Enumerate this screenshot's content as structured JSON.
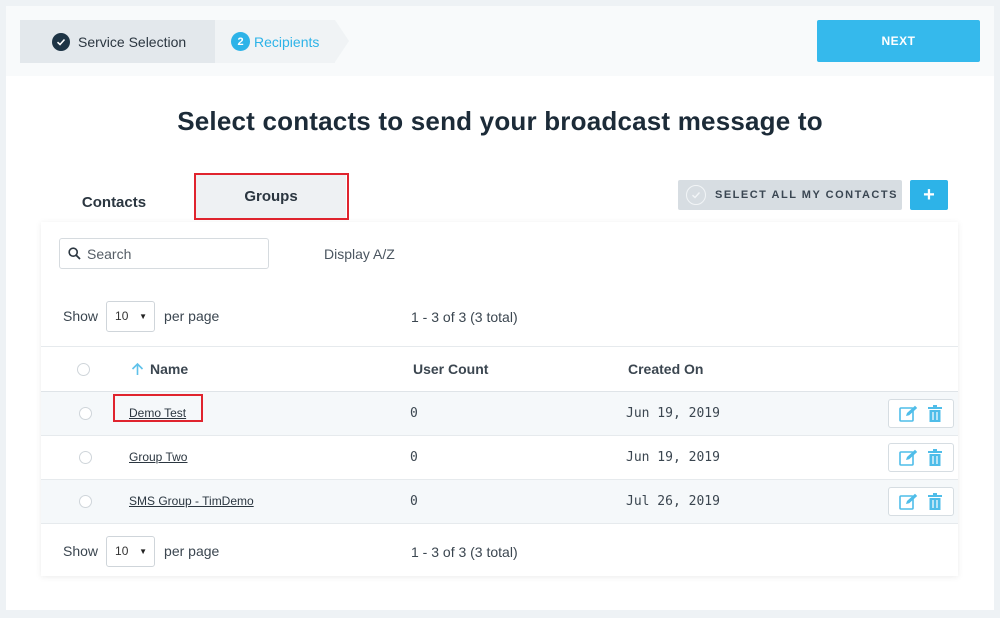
{
  "wizard": {
    "step1_label": "Service Selection",
    "step2_number": "2",
    "step2_label": "Recipients",
    "next_label": "NEXT"
  },
  "page_title": "Select contacts to send your broadcast message to",
  "tabs": [
    {
      "label": "Contacts",
      "active": false
    },
    {
      "label": "Groups",
      "active": true
    }
  ],
  "toolbar": {
    "select_all_label": "SELECT ALL MY CONTACTS",
    "add_label": "+"
  },
  "search": {
    "placeholder": "Search",
    "value": ""
  },
  "display_az_label": "Display A/Z",
  "pagination": {
    "show_label": "Show",
    "per_page_value": "10",
    "per_page_label": "per page",
    "range_text": "1 - 3 of 3 (3 total)"
  },
  "table": {
    "columns": [
      "Name",
      "User Count",
      "Created On"
    ],
    "rows": [
      {
        "name": "Demo Test",
        "user_count": "0",
        "created_on": "Jun 19, 2019"
      },
      {
        "name": "Group Two",
        "user_count": "0",
        "created_on": "Jun 19, 2019"
      },
      {
        "name": "SMS Group - TimDemo",
        "user_count": "0",
        "created_on": "Jul 26, 2019"
      }
    ]
  },
  "colors": {
    "accent": "#2db3e8",
    "dark": "#1e3445",
    "highlight_box": "#e0242e"
  },
  "icons": [
    "check-icon",
    "search-icon",
    "sort-arrow-up-icon",
    "edit-icon",
    "trash-icon",
    "caret-down-icon"
  ]
}
